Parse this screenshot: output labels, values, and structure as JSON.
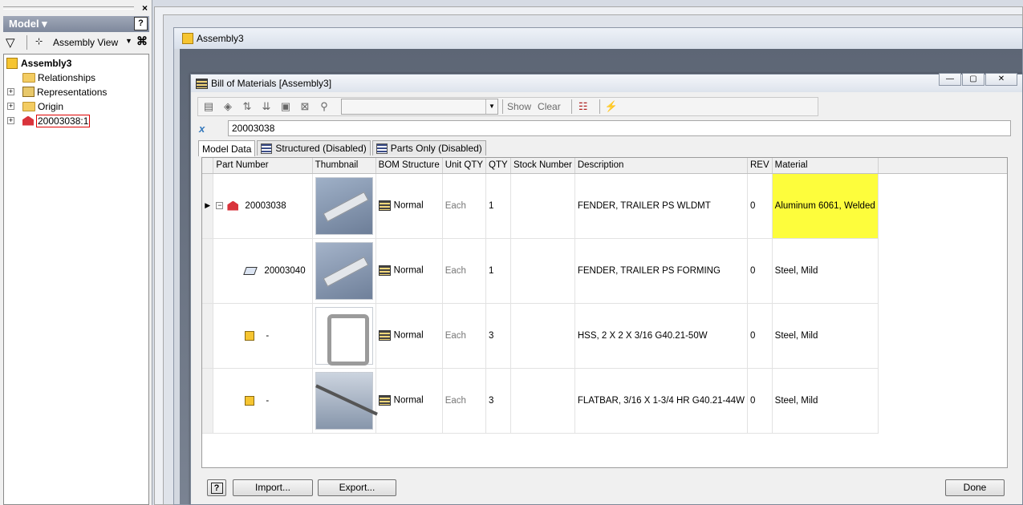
{
  "model_panel": {
    "close_glyph": "×",
    "header": "Model ▾",
    "help_glyph": "?",
    "view_label": "Assembly View",
    "tree": [
      {
        "label": "Assembly3",
        "kind": "assembly"
      },
      {
        "label": "Relationships",
        "kind": "folder"
      },
      {
        "label": "Representations",
        "kind": "representations"
      },
      {
        "label": "Origin",
        "kind": "folder"
      },
      {
        "label": "20003038:1",
        "kind": "weldment"
      }
    ]
  },
  "doc_window": {
    "title": "Assembly3"
  },
  "bom": {
    "title": "Bill of Materials [Assembly3]",
    "toolbar": {
      "show_label": "Show",
      "clear_label": "Clear"
    },
    "formula_value": "20003038",
    "tabs": [
      {
        "label": "Model Data"
      },
      {
        "label": "Structured (Disabled)"
      },
      {
        "label": "Parts Only (Disabled)"
      }
    ],
    "columns": [
      "Part Number",
      "Thumbnail",
      "BOM Structure",
      "Unit QTY",
      "QTY",
      "Stock Number",
      "Description",
      "REV",
      "Material"
    ],
    "rows": [
      {
        "part_number": "20003038",
        "bom_structure": "Normal",
        "unit_qty": "Each",
        "qty": "1",
        "stock_number": "",
        "description": "FENDER, TRAILER PS WLDMT",
        "rev": "0",
        "material": "Aluminum 6061, Welded"
      },
      {
        "part_number": "20003040",
        "bom_structure": "Normal",
        "unit_qty": "Each",
        "qty": "1",
        "stock_number": "",
        "description": "FENDER, TRAILER PS FORMING",
        "rev": "0",
        "material": "Steel, Mild"
      },
      {
        "part_number": "-",
        "bom_structure": "Normal",
        "unit_qty": "Each",
        "qty": "3",
        "stock_number": "",
        "description": "HSS, 2 X 2 X 3/16 G40.21-50W",
        "rev": "0",
        "material": "Steel, Mild"
      },
      {
        "part_number": "-",
        "bom_structure": "Normal",
        "unit_qty": "Each",
        "qty": "3",
        "stock_number": "",
        "description": "FLATBAR, 3/16 X 1-3/4 HR G40.21-44W",
        "rev": "0",
        "material": "Steel, Mild"
      }
    ],
    "buttons": {
      "help": "?",
      "import": "Import...",
      "export": "Export...",
      "done": "Done"
    },
    "highlight_color": "#fdfd3c"
  }
}
